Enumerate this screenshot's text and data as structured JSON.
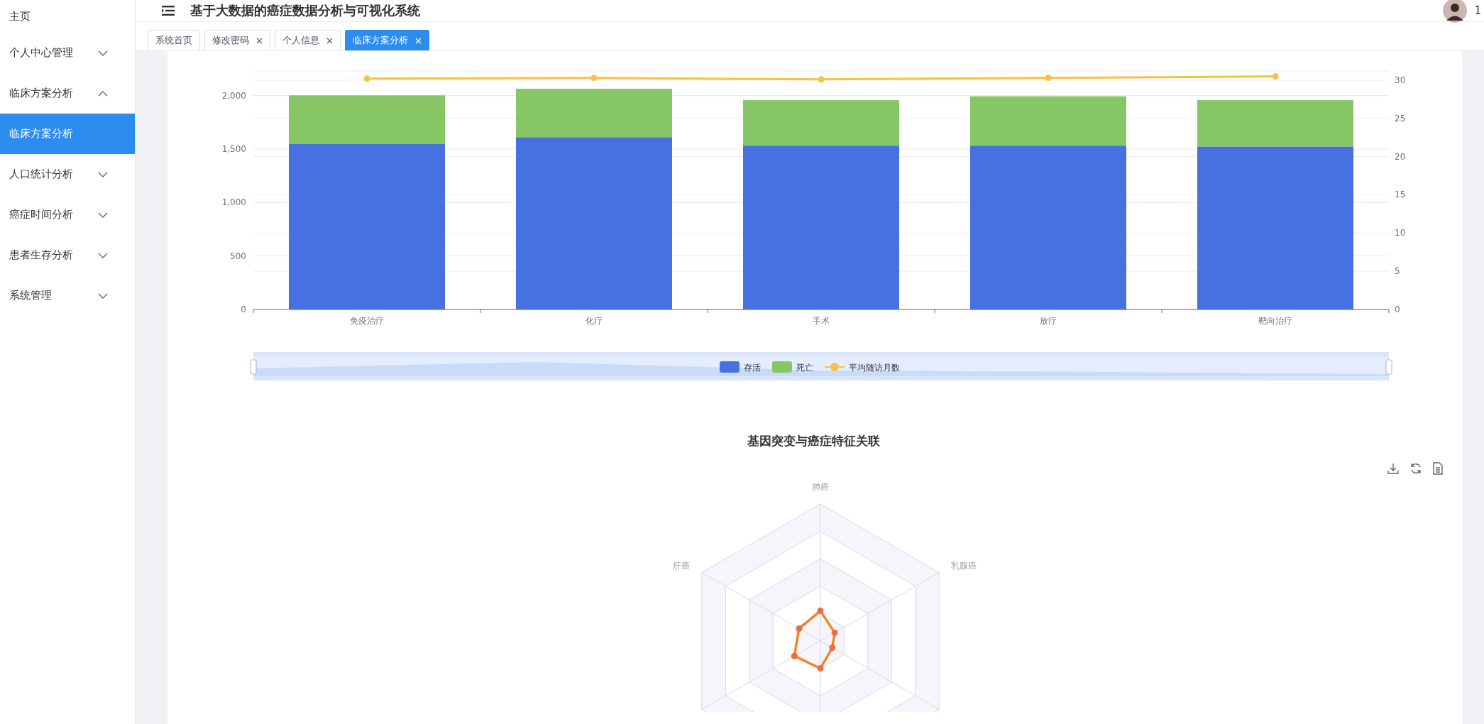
{
  "sidebar": {
    "items": [
      {
        "label": "主页",
        "kind": "link",
        "selected": false
      },
      {
        "label": "个人中心管理",
        "kind": "group",
        "expanded": false,
        "selected": false
      },
      {
        "label": "临床方案分析",
        "kind": "group",
        "expanded": true,
        "selected": false,
        "children": [
          {
            "label": "临床方案分析",
            "selected": true
          }
        ]
      },
      {
        "label": "人口统计分析",
        "kind": "group",
        "expanded": false,
        "selected": false
      },
      {
        "label": "癌症时间分析",
        "kind": "group",
        "expanded": false,
        "selected": false
      },
      {
        "label": "患者生存分析",
        "kind": "group",
        "expanded": false,
        "selected": false
      },
      {
        "label": "系统管理",
        "kind": "group",
        "expanded": false,
        "selected": false
      }
    ]
  },
  "header": {
    "title": "基于大数据的癌症数据分析与可视化系统",
    "username": "1"
  },
  "tabs": [
    {
      "label": "系统首页",
      "closable": false,
      "selected": false
    },
    {
      "label": "修改密码",
      "closable": true,
      "selected": false
    },
    {
      "label": "个人信息",
      "closable": true,
      "selected": false
    },
    {
      "label": "临床方案分析",
      "closable": true,
      "selected": true
    }
  ],
  "treatment_chart": {
    "chart_data": {
      "type": "bar",
      "stacked": true,
      "categories": [
        "免疫治疗",
        "化疗",
        "手术",
        "放疗",
        "靶向治疗"
      ],
      "series": [
        {
          "name": "存活",
          "color": "#4771e0",
          "values": [
            1550,
            1611,
            1532,
            1532,
            1524
          ]
        },
        {
          "name": "死亡",
          "color": "#86c664",
          "values": [
            452,
            453,
            425,
            461,
            433
          ]
        },
        {
          "name": "平均随访月数",
          "type": "line",
          "axis": "y2",
          "marker": true,
          "color": "#f7c142",
          "values": [
            30.2,
            30.3,
            30.1,
            30.3,
            30.5
          ]
        }
      ],
      "grid": true,
      "legend": true,
      "ylim": [
        0,
        2230
      ],
      "yticks": [
        {
          "value": 0,
          "label": "0"
        },
        {
          "value": 500,
          "label": "500"
        },
        {
          "value": 1000,
          "label": "1,000"
        },
        {
          "value": 1500,
          "label": "1,500"
        },
        {
          "value": 2000,
          "label": "2,000"
        }
      ],
      "y2lim": [
        0,
        31.2
      ],
      "y2ticks": [
        0,
        5,
        10,
        15,
        20,
        25,
        30
      ]
    }
  },
  "radar_chart": {
    "title": "基因突变与癌症特征关联",
    "indicators": [
      "肺癌",
      "乳腺癌",
      "肝癌"
    ]
  }
}
